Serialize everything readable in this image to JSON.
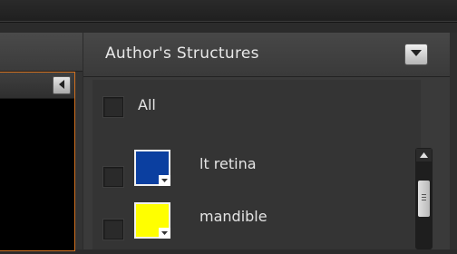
{
  "panel": {
    "title": "Author's Structures",
    "all_label": "All"
  },
  "structures": [
    {
      "label": "lt retina",
      "color": "#0b3fa0",
      "checked": false
    },
    {
      "label": "mandible",
      "color": "#ffff00",
      "checked": false
    }
  ],
  "icons": {
    "dropdown": "chevron-down-icon",
    "viewer_arrow": "chevron-left-icon",
    "swatch_menu": "small-chevron-down-icon",
    "scroll_up": "chevron-up-icon",
    "scroll_grip": "grip-icon"
  }
}
